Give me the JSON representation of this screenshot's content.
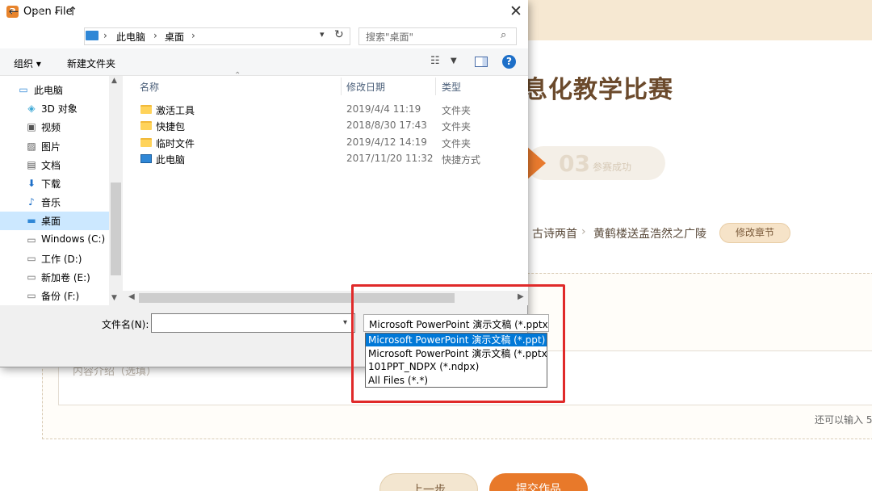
{
  "web": {
    "title": "息化教学比赛",
    "step": {
      "number": "03",
      "label": "参赛成功"
    },
    "breadcrumb": [
      "古诗两首",
      "黄鹤楼送孟浩然之广陵"
    ],
    "breadcrumb_sep": "›",
    "edit_chapter_label": "修改章节",
    "description_placeholder": "内容介绍（选填）",
    "remaining_label": "还可以输入 5",
    "prev_button": "上一步",
    "submit_button": "提交作品",
    "accent_color": "#e8792a"
  },
  "dialog": {
    "title": "Open File",
    "app_icon_glyph": "P",
    "address": {
      "segments": [
        "此电脑",
        "桌面"
      ]
    },
    "search_placeholder": "搜索\"桌面\"",
    "commands": {
      "organize": "组织 ▾",
      "new_folder": "新建文件夹"
    },
    "nav_items": [
      {
        "label": "此电脑",
        "icon": "computer-icon"
      },
      {
        "label": "3D 对象",
        "icon": "3d-objects-icon"
      },
      {
        "label": "视频",
        "icon": "video-icon"
      },
      {
        "label": "图片",
        "icon": "pictures-icon"
      },
      {
        "label": "文档",
        "icon": "documents-icon"
      },
      {
        "label": "下载",
        "icon": "download-icon"
      },
      {
        "label": "音乐",
        "icon": "music-icon"
      },
      {
        "label": "桌面",
        "icon": "desktop-icon",
        "selected": true
      },
      {
        "label": "Windows (C:)",
        "icon": "drive-icon"
      },
      {
        "label": "工作 (D:)",
        "icon": "drive-icon"
      },
      {
        "label": "新加卷 (E:)",
        "icon": "drive-icon"
      },
      {
        "label": "备份 (F:)",
        "icon": "drive-icon"
      }
    ],
    "columns": {
      "name": "名称",
      "date": "修改日期",
      "type": "类型"
    },
    "files": [
      {
        "name": "激活工具",
        "date": "2019/4/4 11:19",
        "type": "文件夹",
        "icon": "folder-icon"
      },
      {
        "name": "快捷包",
        "date": "2018/8/30 17:43",
        "type": "文件夹",
        "icon": "folder-icon"
      },
      {
        "name": "临时文件",
        "date": "2019/4/12 14:19",
        "type": "文件夹",
        "icon": "folder-icon"
      },
      {
        "name": "此电脑",
        "date": "2017/11/20 11:32",
        "type": "快捷方式",
        "icon": "shortcut-icon"
      }
    ],
    "filename_label": "文件名(N):",
    "filename_value": "",
    "filetype_selected": "Microsoft PowerPoint 演示文稿 (*.pptx)",
    "filetype_options": [
      "Microsoft PowerPoint 演示文稿 (*.ppt)",
      "Microsoft PowerPoint 演示文稿 (*.pptx)",
      "101PPT_NDPX (*.ndpx)",
      "All Files (*.*)"
    ],
    "highlighted_option_index": 0
  }
}
